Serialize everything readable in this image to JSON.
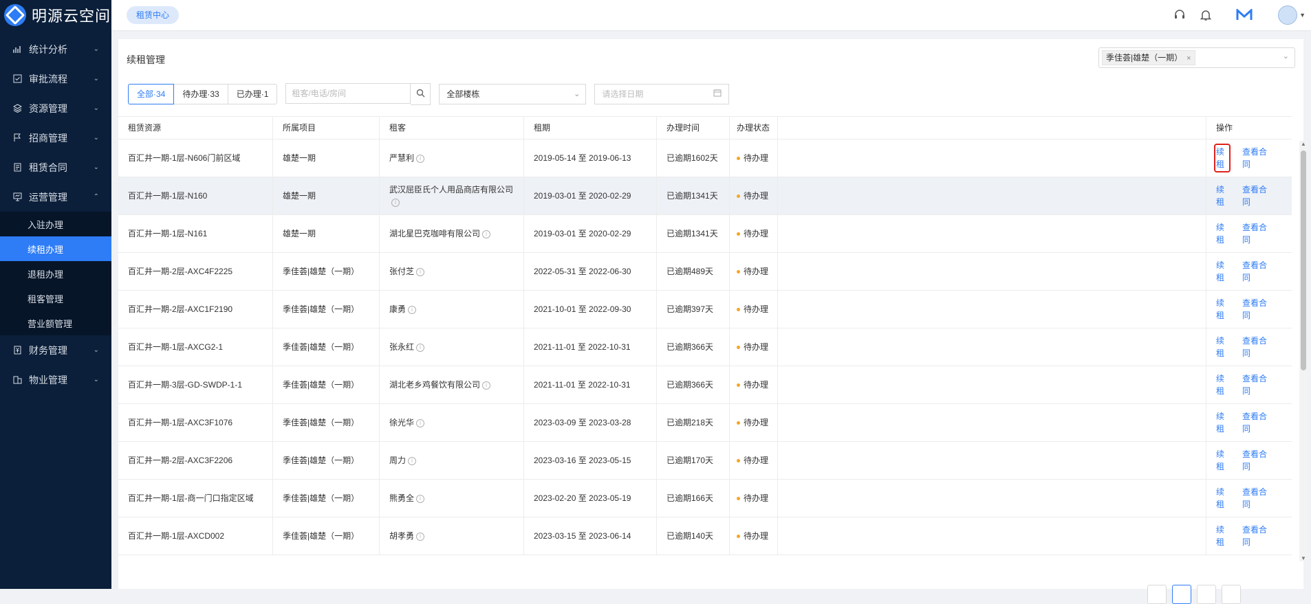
{
  "brand": {
    "name": "明源云空间"
  },
  "sidebar": {
    "items": [
      {
        "label": "统计分析",
        "icon": "chart-icon"
      },
      {
        "label": "审批流程",
        "icon": "approve-icon"
      },
      {
        "label": "资源管理",
        "icon": "layers-icon"
      },
      {
        "label": "招商管理",
        "icon": "flag-icon"
      },
      {
        "label": "租赁合同",
        "icon": "contract-icon"
      },
      {
        "label": "运营管理",
        "icon": "monitor-icon"
      },
      {
        "label": "财务管理",
        "icon": "finance-icon"
      },
      {
        "label": "物业管理",
        "icon": "building-icon"
      }
    ],
    "sub_items": [
      "入驻办理",
      "续租办理",
      "退租办理",
      "租客管理",
      "营业额管理"
    ],
    "active_sub": "续租办理"
  },
  "header": {
    "tag": "租赁中心",
    "icons": [
      "headset-icon",
      "bell-icon",
      "m-logo-icon",
      "avatar"
    ]
  },
  "page": {
    "title": "续租管理",
    "project_chip": "季佳荟|雄楚（一期）",
    "project_chip_close": "×",
    "tabs": [
      "全部·34",
      "待办理·33",
      "已办理·1"
    ],
    "search_placeholder": "租客/电话/房间",
    "building_select": "全部楼栋",
    "date_placeholder": "请选择日期"
  },
  "table": {
    "columns": [
      "租赁资源",
      "所属项目",
      "租客",
      "租期",
      "办理时间",
      "办理状态",
      "",
      "操作"
    ],
    "rows": [
      {
        "resource": "百汇井一期-1层-N606门前区域",
        "project": "雄楚一期",
        "tenant": "严慧利",
        "term": "2019-05-14 至 2019-06-13",
        "time": "已逾期1602天",
        "status": "待办理"
      },
      {
        "resource": "百汇井一期-1层-N160",
        "project": "雄楚一期",
        "tenant": "武汉屈臣氏个人用品商店有限公司",
        "term": "2019-03-01 至 2020-02-29",
        "time": "已逾期1341天",
        "status": "待办理"
      },
      {
        "resource": "百汇井一期-1层-N161",
        "project": "雄楚一期",
        "tenant": "湖北星巴克咖啡有限公司",
        "term": "2019-03-01 至 2020-02-29",
        "time": "已逾期1341天",
        "status": "待办理"
      },
      {
        "resource": "百汇井一期-2层-AXC4F2225",
        "project": "季佳荟|雄楚（一期）",
        "tenant": "张付芝",
        "term": "2022-05-31 至 2022-06-30",
        "time": "已逾期489天",
        "status": "待办理"
      },
      {
        "resource": "百汇井一期-2层-AXC1F2190",
        "project": "季佳荟|雄楚（一期）",
        "tenant": "康勇",
        "term": "2021-10-01 至 2022-09-30",
        "time": "已逾期397天",
        "status": "待办理"
      },
      {
        "resource": "百汇井一期-1层-AXCG2-1",
        "project": "季佳荟|雄楚（一期）",
        "tenant": "张永红",
        "term": "2021-11-01 至 2022-10-31",
        "time": "已逾期366天",
        "status": "待办理"
      },
      {
        "resource": "百汇井一期-3层-GD-SWDP-1-1",
        "project": "季佳荟|雄楚（一期）",
        "tenant": "湖北老乡鸡餐饮有限公司",
        "term": "2021-11-01 至 2022-10-31",
        "time": "已逾期366天",
        "status": "待办理"
      },
      {
        "resource": "百汇井一期-1层-AXC3F1076",
        "project": "季佳荟|雄楚（一期）",
        "tenant": "徐光华",
        "term": "2023-03-09 至 2023-03-28",
        "time": "已逾期218天",
        "status": "待办理"
      },
      {
        "resource": "百汇井一期-2层-AXC3F2206",
        "project": "季佳荟|雄楚（一期）",
        "tenant": "周力",
        "term": "2023-03-16 至 2023-05-15",
        "time": "已逾期170天",
        "status": "待办理"
      },
      {
        "resource": "百汇井一期-1层-商一门口指定区域",
        "project": "季佳荟|雄楚（一期）",
        "tenant": "熊勇全",
        "term": "2023-02-20 至 2023-05-19",
        "time": "已逾期166天",
        "status": "待办理"
      },
      {
        "resource": "百汇井一期-1层-AXCD002",
        "project": "季佳荟|雄楚（一期）",
        "tenant": "胡孝勇",
        "term": "2023-03-15 至 2023-06-14",
        "time": "已逾期140天",
        "status": "待办理"
      }
    ],
    "op_renew": "续租",
    "op_view": "查看合同"
  },
  "colors": {
    "sidebar_bg": "#0b1f3a",
    "accent": "#2e7cf6",
    "status_dot": "#f5a623",
    "highlight": "#e0201a"
  }
}
